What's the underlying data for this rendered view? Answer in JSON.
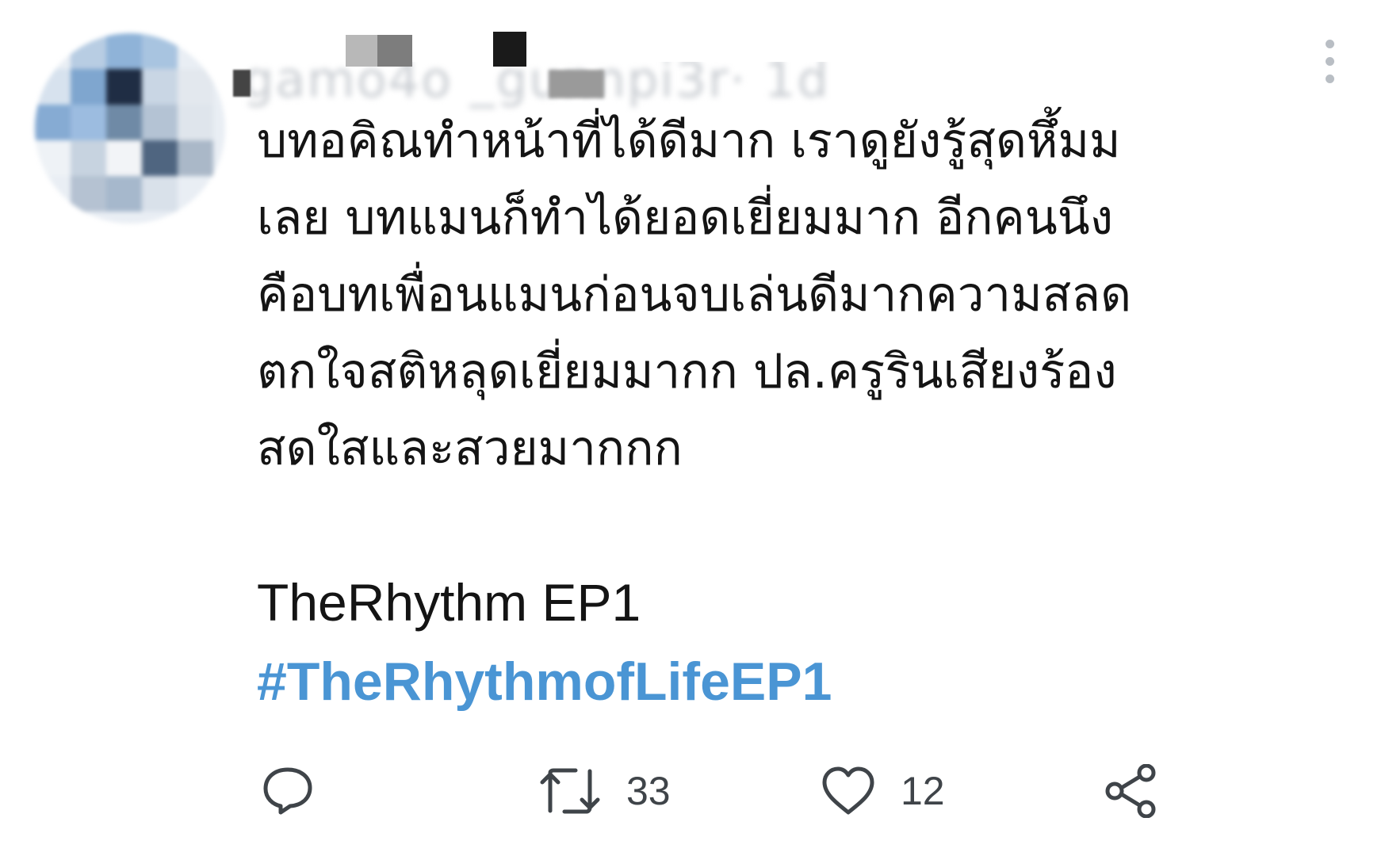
{
  "tweet": {
    "author": {
      "name_obscured": "gamo4o _gunnpi3r· 1d"
    },
    "body_lines": [
      "บทอคิณทำหน้าที่ได้ดีมาก เราดูยังรู้สุดหึ้มม",
      "เลย บทแมนก็ทำได้ยอดเยี่ยมมาก อีกคนนึง",
      "คือบทเพื่อนแมนก่อนจบเล่นดีมากความสลด",
      "ตกใจสติหลุดเยี่ยมมากก ปล.ครูรินเสียงร้อง",
      "สดใสและสวยมากกก"
    ],
    "tag_text": "TheRhythm EP1",
    "hashtag": "#TheRhythmofLifeEP1",
    "hashtag_color": "#4a95d4",
    "actions": {
      "reply": {
        "icon": "reply-icon"
      },
      "retweet": {
        "icon": "retweet-icon",
        "count": "33"
      },
      "like": {
        "icon": "heart-icon",
        "count": "12"
      },
      "share": {
        "icon": "share-icon"
      }
    },
    "icon_color": "#3f4449"
  }
}
